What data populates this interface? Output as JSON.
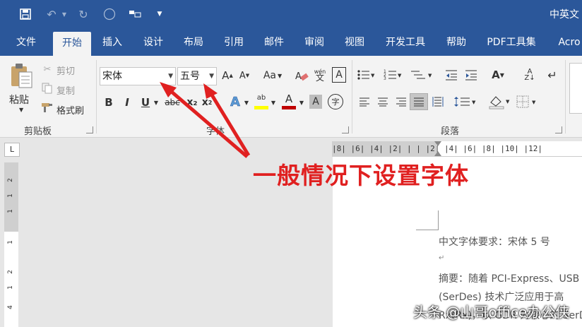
{
  "titlebar": {
    "doc_title": "中英文"
  },
  "tabs": [
    "文件",
    "开始",
    "插入",
    "设计",
    "布局",
    "引用",
    "邮件",
    "审阅",
    "视图",
    "开发工具",
    "帮助",
    "PDF工具集",
    "Acro"
  ],
  "clipboard": {
    "paste": "粘贴",
    "cut": "剪切",
    "copy": "复制",
    "format_painter": "格式刷",
    "group_label": "剪贴板"
  },
  "font": {
    "name_value": "宋体",
    "size_value": "五号",
    "group_label": "字体",
    "bold": "B",
    "italic": "I",
    "underline": "U",
    "strike": "abc",
    "subscript": "x₂",
    "superscript": "x",
    "grow": "A",
    "shrink": "A",
    "case": "Aa",
    "wen": "wén",
    "boxed": "A",
    "shade": "A",
    "circle": "字",
    "font_color": "A",
    "highlight": "ab"
  },
  "paragraph": {
    "group_label": "段落"
  },
  "ruler": {
    "corner": "L",
    "top": "|8|  |6|  |4|  |2|  |  |  |2|  |4|  |6|  |8|  |10|  |12|",
    "left": [
      "2",
      "1",
      "1",
      "1",
      "2",
      "1",
      "4"
    ]
  },
  "annotation": "一般情况下设置字体",
  "document": {
    "line1": "中文字体要求：宋体 5 号",
    "line2": "↵",
    "line3": "摘要：随着 PCI-Express、USB",
    "line4": "(SerDes) 技术广泛应用于高",
    "line5": "Rx(Rx)，以 GDR 为核心的 SerDes"
  },
  "watermark": "头条 @山哥office办公侠",
  "colors": {
    "brand": "#2b579a",
    "annotation": "#e02020",
    "font_color_bar": "#c00000",
    "highlight_bar": "#ffff00"
  }
}
